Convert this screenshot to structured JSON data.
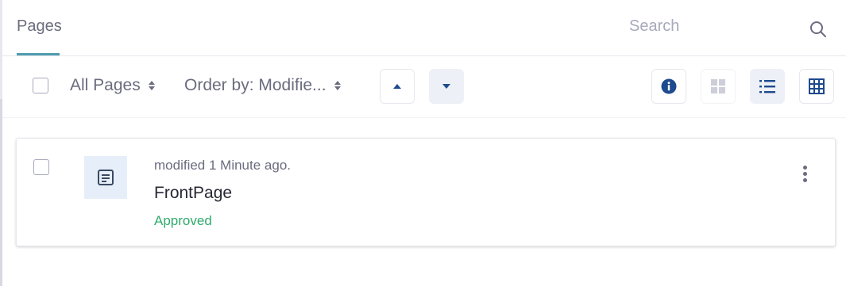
{
  "header": {
    "tab_label": "Pages",
    "search_placeholder": "Search"
  },
  "toolbar": {
    "filter_label": "All Pages",
    "order_label": "Order by: Modifie...",
    "buttons": {
      "ascending": "caret-top-icon",
      "descending": "caret-bottom-icon",
      "info": "info-circle-icon",
      "cards_view": "cards-icon",
      "list_view": "list-icon",
      "table_view": "table-icon"
    }
  },
  "items": [
    {
      "meta": "modified 1 Minute ago.",
      "title": "FrontPage",
      "status": "Approved",
      "icon": "wiki-page-icon"
    }
  ],
  "colors": {
    "accent": "#2e8ba0",
    "icon_blue": "#1e4a8e",
    "status_green": "#2fab6b",
    "muted_text": "#6b6c7e"
  }
}
